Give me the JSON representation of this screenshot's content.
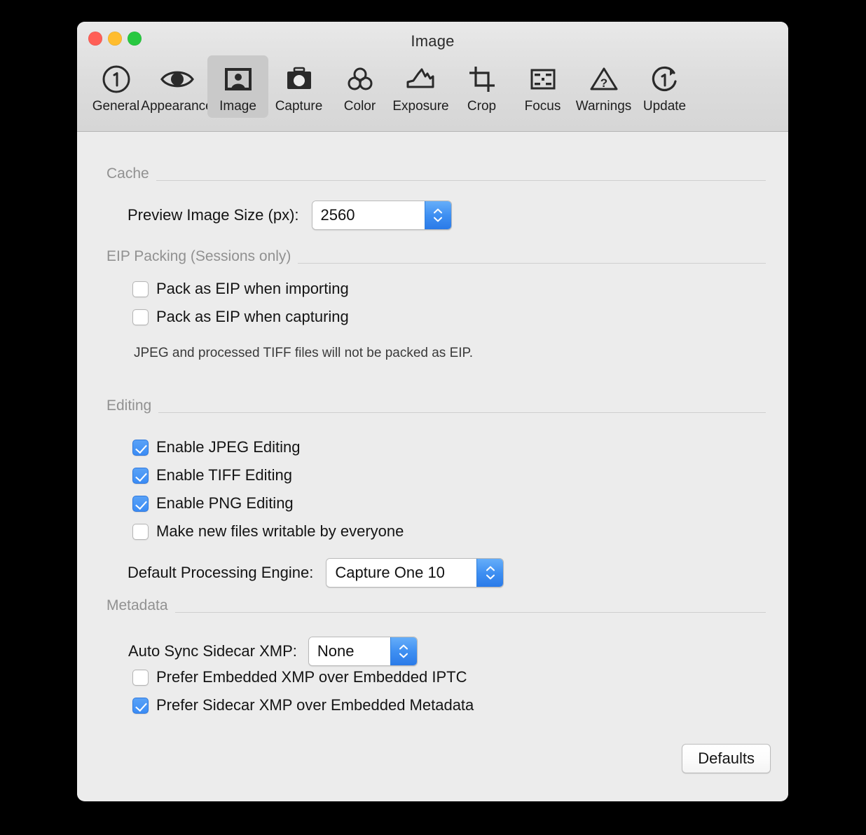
{
  "window": {
    "title": "Image",
    "traffic_lights": [
      {
        "name": "close",
        "color": "#ff5f57"
      },
      {
        "name": "minimize",
        "color": "#ffbd2e"
      },
      {
        "name": "zoom",
        "color": "#28c840"
      }
    ]
  },
  "toolbar": {
    "selected": "Image",
    "tabs": [
      {
        "label": "General",
        "icon": "circled-number-one-icon"
      },
      {
        "label": "Appearance",
        "icon": "eye-icon"
      },
      {
        "label": "Image",
        "icon": "portrait-photo-icon"
      },
      {
        "label": "Capture",
        "icon": "camera-icon"
      },
      {
        "label": "Color",
        "icon": "three-circles-icon"
      },
      {
        "label": "Exposure",
        "icon": "histogram-curve-icon"
      },
      {
        "label": "Crop",
        "icon": "crop-marks-icon"
      },
      {
        "label": "Focus",
        "icon": "focus-grid-icon"
      },
      {
        "label": "Warnings",
        "icon": "warning-triangle-question-icon"
      },
      {
        "label": "Update",
        "icon": "refresh-number-one-icon"
      }
    ]
  },
  "sections": {
    "cache": {
      "title": "Cache",
      "preview_image_size": {
        "label": "Preview Image Size (px):",
        "value": "2560"
      }
    },
    "eip_packing": {
      "title": "EIP Packing (Sessions only)",
      "pack_importing": {
        "label": "Pack as EIP when importing",
        "checked": false
      },
      "pack_capturing": {
        "label": "Pack as EIP when capturing",
        "checked": false
      },
      "note": "JPEG and processed TIFF files will not be packed as EIP."
    },
    "editing": {
      "title": "Editing",
      "enable_jpeg": {
        "label": "Enable JPEG Editing",
        "checked": true
      },
      "enable_tiff": {
        "label": "Enable TIFF Editing",
        "checked": true
      },
      "enable_png": {
        "label": "Enable PNG Editing",
        "checked": true
      },
      "writable": {
        "label": "Make new files writable by everyone",
        "checked": false
      },
      "processing_engine": {
        "label": "Default Processing Engine:",
        "value": "Capture One 10"
      }
    },
    "metadata": {
      "title": "Metadata",
      "auto_sync": {
        "label": "Auto Sync Sidecar XMP:",
        "value": "None"
      },
      "prefer_embedded": {
        "label": "Prefer Embedded XMP over Embedded IPTC",
        "checked": false
      },
      "prefer_sidecar": {
        "label": "Prefer Sidecar XMP over Embedded Metadata",
        "checked": true
      }
    }
  },
  "footer": {
    "defaults_label": "Defaults"
  },
  "colors": {
    "accent": "#3b8cf5",
    "window_bg": "#ececec",
    "titlebar_bg": "#dcdcdc",
    "selected_tab_bg": "#c9c9c9",
    "section_label": "#919191"
  }
}
